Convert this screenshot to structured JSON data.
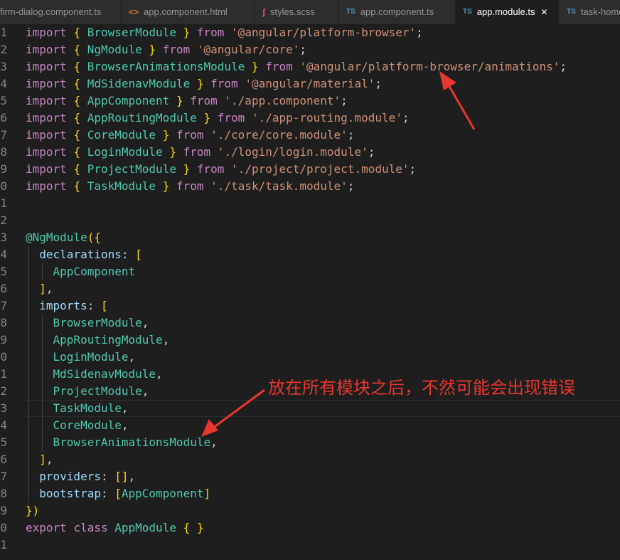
{
  "tabs": [
    {
      "icon": "angular-icon",
      "label": "firm-dialog.component.ts",
      "active": false
    },
    {
      "icon": "html-file-icon",
      "label": "app.component.html",
      "active": false
    },
    {
      "icon": "scss-file-icon",
      "label": "styles.scss",
      "active": false
    },
    {
      "icon": "ts-file-icon",
      "label": "app.component.ts",
      "active": false
    },
    {
      "icon": "ts-file-icon",
      "label": "app.module.ts",
      "active": true
    },
    {
      "icon": "ts-file-icon",
      "label": "task-home",
      "active": false
    }
  ],
  "icon_labels": {
    "ts": "TS",
    "html": "<>",
    "scss": "ʃ",
    "close": "✕"
  },
  "colors": {
    "keyword": "#c586c0",
    "import_keyword": "#c586c0",
    "identifier": "#4ec9b0",
    "string": "#ce9178",
    "property": "#9cdcfe",
    "brace": "#ffd700",
    "punctuation": "#d4d4d4",
    "annotation": "#e8372e"
  },
  "code": {
    "line_numbers": [
      "1",
      "2",
      "3",
      "4",
      "5",
      "6",
      "7",
      "8",
      "9",
      "0",
      "1",
      "2",
      "3",
      "4",
      "5",
      "6",
      "7",
      "8",
      "9",
      "0",
      "1",
      "2",
      "3",
      "4",
      "5",
      "6",
      "7",
      "8",
      "9",
      "0",
      "1"
    ],
    "lines": [
      [
        {
          "t": "import",
          "c": "kw"
        },
        {
          "t": " "
        },
        {
          "t": "{",
          "c": "br"
        },
        {
          "t": " "
        },
        {
          "t": "BrowserModule",
          "c": "id"
        },
        {
          "t": " "
        },
        {
          "t": "}",
          "c": "br"
        },
        {
          "t": " "
        },
        {
          "t": "from",
          "c": "kw"
        },
        {
          "t": " "
        },
        {
          "t": "'@angular/platform-browser'",
          "c": "str"
        },
        {
          "t": ";"
        }
      ],
      [
        {
          "t": "import",
          "c": "kw"
        },
        {
          "t": " "
        },
        {
          "t": "{",
          "c": "br"
        },
        {
          "t": " "
        },
        {
          "t": "NgModule",
          "c": "id"
        },
        {
          "t": " "
        },
        {
          "t": "}",
          "c": "br"
        },
        {
          "t": " "
        },
        {
          "t": "from",
          "c": "kw"
        },
        {
          "t": " "
        },
        {
          "t": "'@angular/core'",
          "c": "str"
        },
        {
          "t": ";"
        }
      ],
      [
        {
          "t": "import",
          "c": "kw"
        },
        {
          "t": " "
        },
        {
          "t": "{",
          "c": "br"
        },
        {
          "t": " "
        },
        {
          "t": "BrowserAnimationsModule",
          "c": "id"
        },
        {
          "t": " "
        },
        {
          "t": "}",
          "c": "br"
        },
        {
          "t": " "
        },
        {
          "t": "from",
          "c": "kw"
        },
        {
          "t": " "
        },
        {
          "t": "'@angular/platform-browser/animations'",
          "c": "str"
        },
        {
          "t": ";"
        }
      ],
      [
        {
          "t": "import",
          "c": "kw"
        },
        {
          "t": " "
        },
        {
          "t": "{",
          "c": "br"
        },
        {
          "t": " "
        },
        {
          "t": "MdSidenavModule",
          "c": "id"
        },
        {
          "t": " "
        },
        {
          "t": "}",
          "c": "br"
        },
        {
          "t": " "
        },
        {
          "t": "from",
          "c": "kw"
        },
        {
          "t": " "
        },
        {
          "t": "'@angular/material'",
          "c": "str"
        },
        {
          "t": ";"
        }
      ],
      [
        {
          "t": "import",
          "c": "kw"
        },
        {
          "t": " "
        },
        {
          "t": "{",
          "c": "br"
        },
        {
          "t": " "
        },
        {
          "t": "AppComponent",
          "c": "id"
        },
        {
          "t": " "
        },
        {
          "t": "}",
          "c": "br"
        },
        {
          "t": " "
        },
        {
          "t": "from",
          "c": "kw"
        },
        {
          "t": " "
        },
        {
          "t": "'./app.component'",
          "c": "str"
        },
        {
          "t": ";"
        }
      ],
      [
        {
          "t": "import",
          "c": "kw"
        },
        {
          "t": " "
        },
        {
          "t": "{",
          "c": "br"
        },
        {
          "t": " "
        },
        {
          "t": "AppRoutingModule",
          "c": "id"
        },
        {
          "t": " "
        },
        {
          "t": "}",
          "c": "br"
        },
        {
          "t": " "
        },
        {
          "t": "from",
          "c": "kw"
        },
        {
          "t": " "
        },
        {
          "t": "'./app-routing.module'",
          "c": "str"
        },
        {
          "t": ";"
        }
      ],
      [
        {
          "t": "import",
          "c": "kw"
        },
        {
          "t": " "
        },
        {
          "t": "{",
          "c": "br"
        },
        {
          "t": " "
        },
        {
          "t": "CoreModule",
          "c": "id"
        },
        {
          "t": " "
        },
        {
          "t": "}",
          "c": "br"
        },
        {
          "t": " "
        },
        {
          "t": "from",
          "c": "kw"
        },
        {
          "t": " "
        },
        {
          "t": "'./core/core.module'",
          "c": "str"
        },
        {
          "t": ";"
        }
      ],
      [
        {
          "t": "import",
          "c": "kw"
        },
        {
          "t": " "
        },
        {
          "t": "{",
          "c": "br"
        },
        {
          "t": " "
        },
        {
          "t": "LoginModule",
          "c": "id"
        },
        {
          "t": " "
        },
        {
          "t": "}",
          "c": "br"
        },
        {
          "t": " "
        },
        {
          "t": "from",
          "c": "kw"
        },
        {
          "t": " "
        },
        {
          "t": "'./login/login.module'",
          "c": "str"
        },
        {
          "t": ";"
        }
      ],
      [
        {
          "t": "import",
          "c": "kw"
        },
        {
          "t": " "
        },
        {
          "t": "{",
          "c": "br"
        },
        {
          "t": " "
        },
        {
          "t": "ProjectModule",
          "c": "id"
        },
        {
          "t": " "
        },
        {
          "t": "}",
          "c": "br"
        },
        {
          "t": " "
        },
        {
          "t": "from",
          "c": "kw"
        },
        {
          "t": " "
        },
        {
          "t": "'./project/project.module'",
          "c": "str"
        },
        {
          "t": ";"
        }
      ],
      [
        {
          "t": "import",
          "c": "kw"
        },
        {
          "t": " "
        },
        {
          "t": "{",
          "c": "br"
        },
        {
          "t": " "
        },
        {
          "t": "TaskModule",
          "c": "id"
        },
        {
          "t": " "
        },
        {
          "t": "}",
          "c": "br"
        },
        {
          "t": " "
        },
        {
          "t": "from",
          "c": "kw"
        },
        {
          "t": " "
        },
        {
          "t": "'./task/task.module'",
          "c": "str"
        },
        {
          "t": ";"
        }
      ],
      [],
      [],
      [
        {
          "t": "@NgModule",
          "c": "id"
        },
        {
          "t": "(",
          "c": "br"
        },
        {
          "t": "{",
          "c": "br"
        }
      ],
      [
        {
          "t": "  "
        },
        {
          "t": "declarations",
          "c": "prop"
        },
        {
          "t": ": "
        },
        {
          "t": "[",
          "c": "br"
        }
      ],
      [
        {
          "t": "    "
        },
        {
          "t": "AppComponent",
          "c": "id"
        }
      ],
      [
        {
          "t": "  "
        },
        {
          "t": "]",
          "c": "br"
        },
        {
          "t": ","
        }
      ],
      [
        {
          "t": "  "
        },
        {
          "t": "imports",
          "c": "prop"
        },
        {
          "t": ": "
        },
        {
          "t": "[",
          "c": "br"
        }
      ],
      [
        {
          "t": "    "
        },
        {
          "t": "BrowserModule",
          "c": "id"
        },
        {
          "t": ","
        }
      ],
      [
        {
          "t": "    "
        },
        {
          "t": "AppRoutingModule",
          "c": "id"
        },
        {
          "t": ","
        }
      ],
      [
        {
          "t": "    "
        },
        {
          "t": "LoginModule",
          "c": "id"
        },
        {
          "t": ","
        }
      ],
      [
        {
          "t": "    "
        },
        {
          "t": "MdSidenavModule",
          "c": "id"
        },
        {
          "t": ","
        }
      ],
      [
        {
          "t": "    "
        },
        {
          "t": "ProjectModule",
          "c": "id"
        },
        {
          "t": ","
        }
      ],
      [
        {
          "t": "    "
        },
        {
          "t": "TaskModule",
          "c": "id"
        },
        {
          "t": ","
        }
      ],
      [
        {
          "t": "    "
        },
        {
          "t": "CoreModule",
          "c": "id"
        },
        {
          "t": ","
        }
      ],
      [
        {
          "t": "    "
        },
        {
          "t": "BrowserAnimationsModule",
          "c": "id"
        },
        {
          "t": ","
        }
      ],
      [
        {
          "t": "  "
        },
        {
          "t": "]",
          "c": "br"
        },
        {
          "t": ","
        }
      ],
      [
        {
          "t": "  "
        },
        {
          "t": "providers",
          "c": "prop"
        },
        {
          "t": ": "
        },
        {
          "t": "[]",
          "c": "br"
        },
        {
          "t": ","
        }
      ],
      [
        {
          "t": "  "
        },
        {
          "t": "bootstrap",
          "c": "prop"
        },
        {
          "t": ": "
        },
        {
          "t": "[",
          "c": "br"
        },
        {
          "t": "AppComponent",
          "c": "id"
        },
        {
          "t": "]",
          "c": "br"
        }
      ],
      [
        {
          "t": "}",
          "c": "br"
        },
        {
          "t": ")",
          "c": "br"
        }
      ],
      [
        {
          "t": "export",
          "c": "kw"
        },
        {
          "t": " "
        },
        {
          "t": "class",
          "c": "kw"
        },
        {
          "t": " "
        },
        {
          "t": "AppModule",
          "c": "id"
        },
        {
          "t": " "
        },
        {
          "t": "{",
          "c": "br"
        },
        {
          "t": " "
        },
        {
          "t": "}",
          "c": "br"
        }
      ],
      []
    ]
  },
  "annotation": {
    "text": "放在所有模块之后，不然可能会出现错误"
  }
}
